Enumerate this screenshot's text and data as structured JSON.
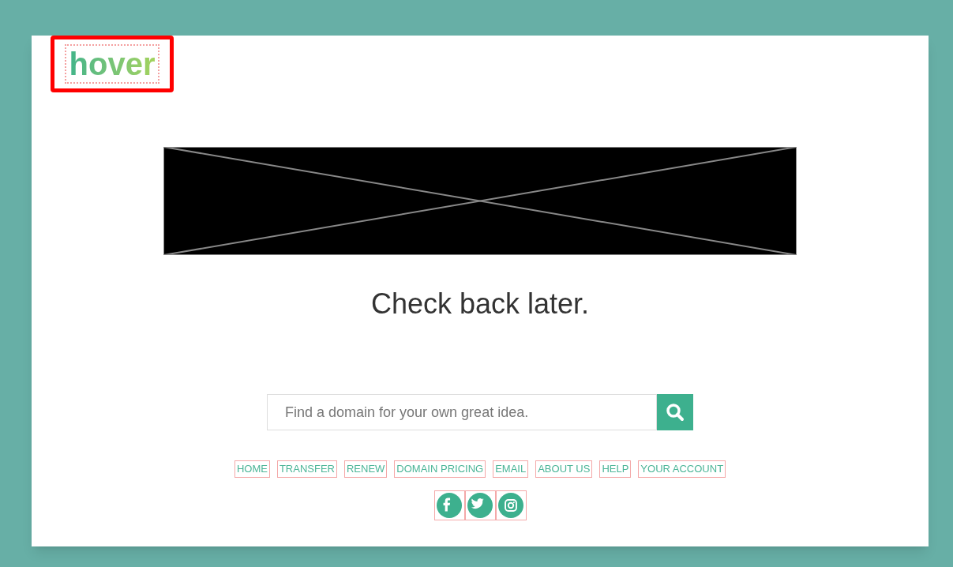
{
  "logo": {
    "text": "hover"
  },
  "headline": "Check back later.",
  "search": {
    "placeholder": "Find a domain for your own great idea."
  },
  "nav_links": [
    "HOME",
    "TRANSFER",
    "RENEW",
    "DOMAIN PRICING",
    "EMAIL",
    "ABOUT US",
    "HELP",
    "YOUR ACCOUNT"
  ],
  "social": [
    {
      "kind": "facebook"
    },
    {
      "kind": "twitter"
    },
    {
      "kind": "instagram"
    }
  ]
}
